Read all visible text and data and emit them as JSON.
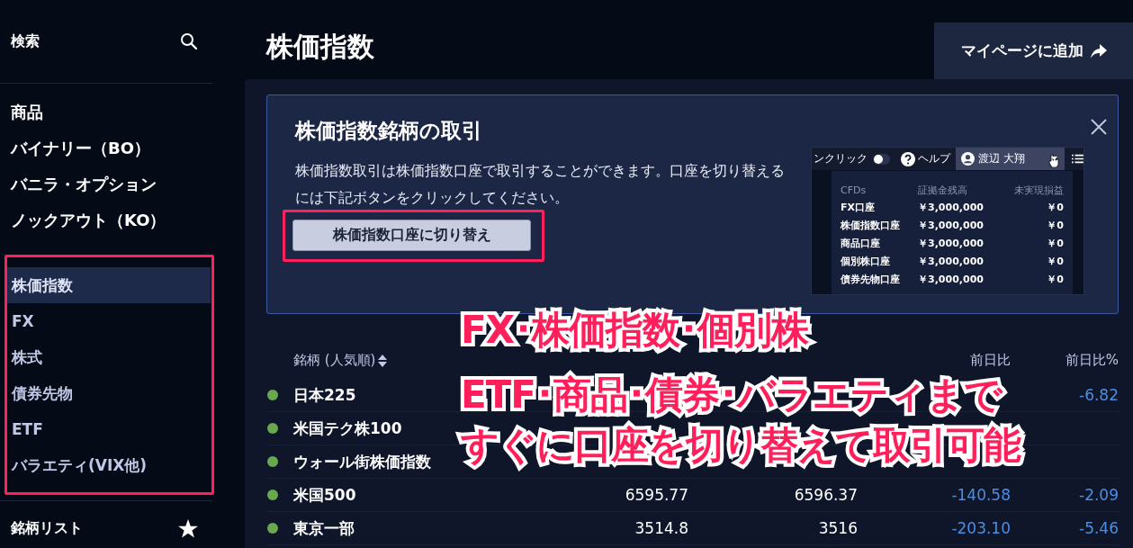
{
  "sidebar": {
    "search_label": "検索",
    "products": [
      "商品",
      "バイナリー（BO）",
      "バニラ・オプション",
      "ノックアウト（KO）"
    ],
    "categories": [
      {
        "label": "株価指数",
        "selected": true
      },
      {
        "label": "FX",
        "selected": false
      },
      {
        "label": "株式",
        "selected": false
      },
      {
        "label": "債券先物",
        "selected": false
      },
      {
        "label": "ETF",
        "selected": false
      },
      {
        "label": "バラエティ(VIX他)",
        "selected": false
      }
    ],
    "watchlist_label": "銘柄リスト"
  },
  "page": {
    "title": "株価指数",
    "add_button": "マイページに追加"
  },
  "banner": {
    "title": "株価指数銘柄の取引",
    "body": "株価指数取引は株価指数口座で取引することができます。口座を切り替えるには下記ボタンをクリックしてください。",
    "button": "株価指数口座に切り替え",
    "preview": {
      "toggle_label": "ンクリック",
      "toggle_on": false,
      "help": "ヘルプ",
      "user": "渡辺 大翔",
      "columns": [
        "CFDs",
        "証拠金残高",
        "未実現損益"
      ],
      "rows": [
        [
          "FX口座",
          "￥3,000,000",
          "￥0"
        ],
        [
          "株価指数口座",
          "￥3,000,000",
          "￥0"
        ],
        [
          "商品口座",
          "￥3,000,000",
          "￥0"
        ],
        [
          "個別株口座",
          "￥3,000,000",
          "￥0"
        ],
        [
          "債券先物口座",
          "￥3,000,000",
          "￥0"
        ]
      ]
    }
  },
  "table": {
    "columns": [
      "銘柄 (人気順)",
      null,
      null,
      "前日比",
      "前日比%"
    ],
    "rows": [
      {
        "name": "日本225",
        "change_pct": "-6.82"
      },
      {
        "name": "米国テク株100"
      },
      {
        "name": "ウォール街株価指数"
      },
      {
        "name": "米国500",
        "bid": "6595.77",
        "ask": "6596.37",
        "change": "-140.58",
        "change_pct": "-2.09"
      },
      {
        "name": "東京一部",
        "bid": "3514.8",
        "ask": "3516",
        "change": "-203.10",
        "change_pct": "-5.46"
      }
    ]
  },
  "annotation": {
    "lines": [
      "FX･株価指数･個別株",
      "ETF･商品･債券･バラエティまで",
      "すぐに口座を切り替えて取引可能"
    ]
  }
}
